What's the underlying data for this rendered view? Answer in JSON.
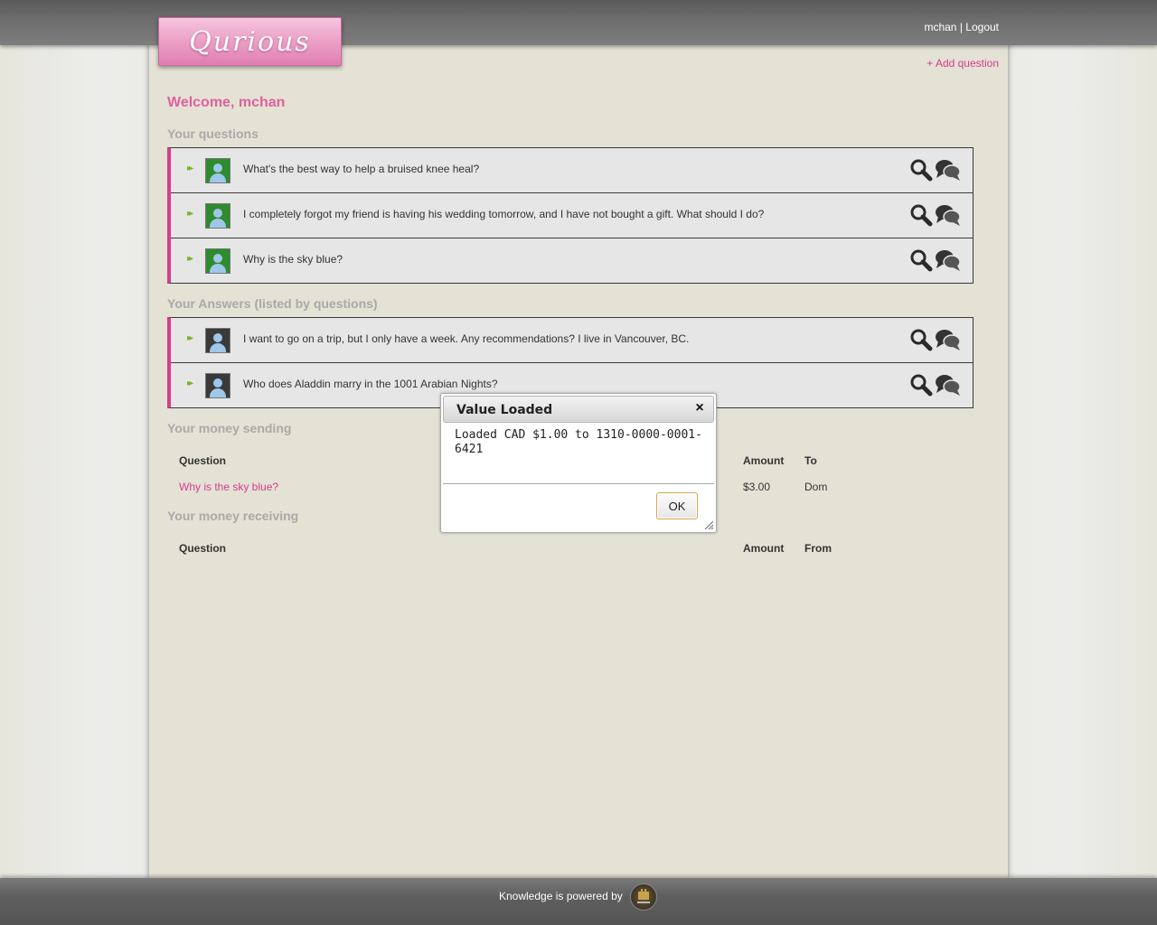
{
  "header": {
    "logo_text": "Qurious",
    "username": "mchan",
    "separator": "|",
    "logout_label": "Logout",
    "add_question_label": "+ Add question"
  },
  "welcome": "Welcome, mchan",
  "your_questions": {
    "title": "Your questions",
    "items": [
      {
        "text": "What's the best way to help a bruised knee heal?"
      },
      {
        "text": "I completely forgot my friend is having his wedding tomorrow, and I have not bought a gift. What should I do?"
      },
      {
        "text": "Why is the sky blue?"
      }
    ]
  },
  "your_answers": {
    "title": "Your Answers (listed by questions)",
    "items": [
      {
        "text": "I want to go on a trip, but I only have a week. Any recommendations? I live in Vancouver, BC."
      },
      {
        "text": "Who does Aladdin marry in the 1001 Arabian Nights?"
      }
    ]
  },
  "money_sending": {
    "title": "Your money sending",
    "headers": {
      "question": "Question",
      "amount": "Amount",
      "to": "To"
    },
    "rows": [
      {
        "question": "Why is the sky blue?",
        "amount": "$3.00",
        "to": "Dom"
      }
    ]
  },
  "money_receiving": {
    "title": "Your money receiving",
    "headers": {
      "question": "Question",
      "amount": "Amount",
      "from": "From"
    }
  },
  "footer": {
    "text": "Knowledge is powered by"
  },
  "dialog": {
    "title": "Value Loaded",
    "close_glyph": "×",
    "message": "Loaded CAD $1.00 to 1310-0000-0001-6421",
    "ok_label": "OK"
  },
  "colors": {
    "accent_pink": "#d83d8c",
    "welcome_pink": "#e0609e",
    "section_gray": "#a9a9a9",
    "arrow_green": "#7fb32a"
  }
}
